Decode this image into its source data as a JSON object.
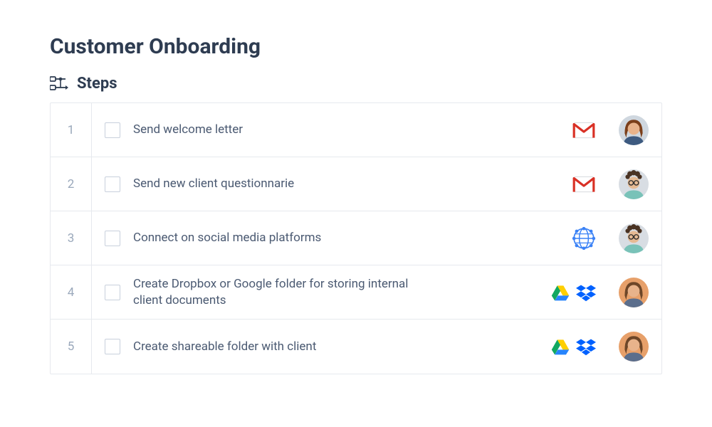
{
  "title": "Customer Onboarding",
  "section_label": "Steps",
  "steps": [
    {
      "num": "1",
      "label": "Send welcome letter",
      "icons": [
        "gmail"
      ],
      "assignee": "person_a"
    },
    {
      "num": "2",
      "label": "Send new client questionnarie",
      "icons": [
        "gmail"
      ],
      "assignee": "person_b"
    },
    {
      "num": "3",
      "label": "Connect on social media platforms",
      "icons": [
        "social"
      ],
      "assignee": "person_b"
    },
    {
      "num": "4",
      "label": "Create Dropbox or Google folder for storing internal client documents",
      "icons": [
        "gdrive",
        "dropbox"
      ],
      "assignee": "person_c"
    },
    {
      "num": "5",
      "label": "Create shareable folder with client",
      "icons": [
        "gdrive",
        "dropbox"
      ],
      "assignee": "person_c"
    }
  ],
  "icon_names": {
    "gmail": "gmail-icon",
    "social": "social-network-icon",
    "gdrive": "google-drive-icon",
    "dropbox": "dropbox-icon"
  },
  "assignees": {
    "person_a": {
      "hair": "#7b3f1a",
      "skin": "#e8b38b",
      "shirt": "#3d5a80",
      "bg": "#cfd7df"
    },
    "person_b": {
      "hair": "#4a3323",
      "skin": "#e6ba93",
      "shirt": "#79c2b8",
      "bg": "#d8dde3"
    },
    "person_c": {
      "hair": "#6d4628",
      "skin": "#e8b38b",
      "shirt": "#5b6e8c",
      "bg": "#e7a06a"
    }
  }
}
